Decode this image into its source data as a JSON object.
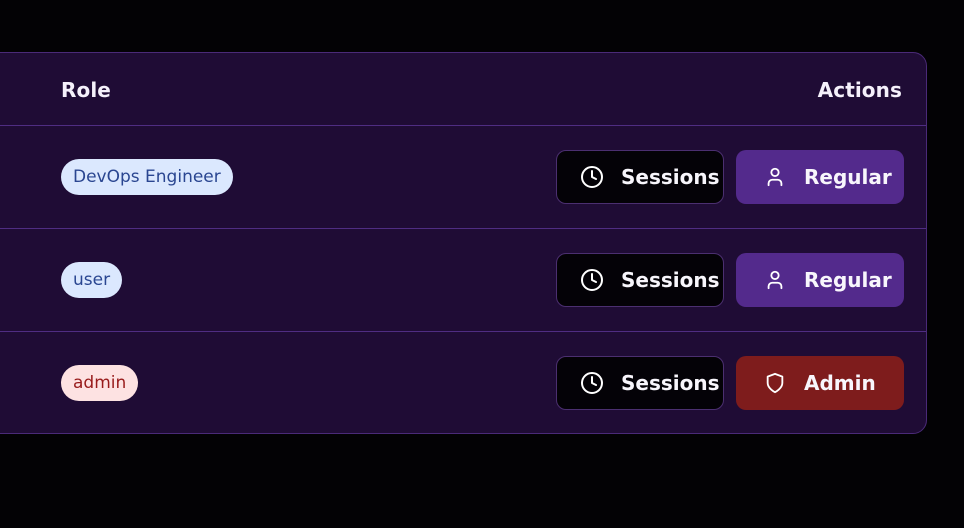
{
  "table": {
    "headers": {
      "role": "Role",
      "actions": "Actions"
    },
    "rows": [
      {
        "role": "DevOps Engineer",
        "role_variant": "blue",
        "sessions_label": "Sessions",
        "level_label": "Regular",
        "level_icon": "user-icon",
        "level_color": "#532a8c"
      },
      {
        "role": "user",
        "role_variant": "blue",
        "sessions_label": "Sessions",
        "level_label": "Regular",
        "level_icon": "user-icon",
        "level_color": "#532a8c"
      },
      {
        "role": "admin",
        "role_variant": "red",
        "sessions_label": "Sessions",
        "level_label": "Admin",
        "level_icon": "shield-icon",
        "level_color": "#7e1c1c"
      }
    ]
  },
  "colors": {
    "background": "#030205",
    "panel": "#1f0c35",
    "divider": "#4f2d82"
  }
}
